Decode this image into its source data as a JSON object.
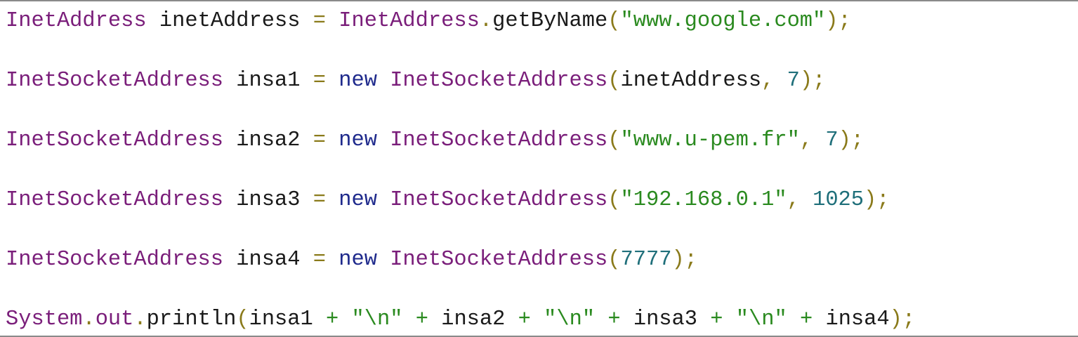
{
  "colors": {
    "type": "#7a1e7a",
    "keyword": "#1f2a8c",
    "string": "#2a8a1f",
    "number": "#1f6f7a",
    "punctuation": "#8a7a1a",
    "identifier": "#1a1a1a",
    "border": "#8a8a8a"
  },
  "code": {
    "lines": [
      {
        "tokens": [
          {
            "t": "type",
            "v": "InetAddress"
          },
          {
            "t": "ident",
            "v": " inetAddress "
          },
          {
            "t": "punct",
            "v": "="
          },
          {
            "t": "ident",
            "v": " "
          },
          {
            "t": "type",
            "v": "InetAddress"
          },
          {
            "t": "punct",
            "v": "."
          },
          {
            "t": "ident",
            "v": "getByName"
          },
          {
            "t": "punct",
            "v": "("
          },
          {
            "t": "str",
            "v": "\"www.google.com\""
          },
          {
            "t": "punct",
            "v": ");"
          }
        ]
      },
      {
        "tokens": [
          {
            "t": "type",
            "v": "InetSocketAddress"
          },
          {
            "t": "ident",
            "v": " insa1 "
          },
          {
            "t": "punct",
            "v": "="
          },
          {
            "t": "ident",
            "v": " "
          },
          {
            "t": "kw",
            "v": "new"
          },
          {
            "t": "ident",
            "v": " "
          },
          {
            "t": "type",
            "v": "InetSocketAddress"
          },
          {
            "t": "punct",
            "v": "("
          },
          {
            "t": "ident",
            "v": "inetAddress"
          },
          {
            "t": "punct",
            "v": ","
          },
          {
            "t": "ident",
            "v": " "
          },
          {
            "t": "num",
            "v": "7"
          },
          {
            "t": "punct",
            "v": ");"
          }
        ]
      },
      {
        "tokens": [
          {
            "t": "type",
            "v": "InetSocketAddress"
          },
          {
            "t": "ident",
            "v": " insa2 "
          },
          {
            "t": "punct",
            "v": "="
          },
          {
            "t": "ident",
            "v": " "
          },
          {
            "t": "kw",
            "v": "new"
          },
          {
            "t": "ident",
            "v": " "
          },
          {
            "t": "type",
            "v": "InetSocketAddress"
          },
          {
            "t": "punct",
            "v": "("
          },
          {
            "t": "str",
            "v": "\"www.u-pem.fr\""
          },
          {
            "t": "punct",
            "v": ","
          },
          {
            "t": "ident",
            "v": " "
          },
          {
            "t": "num",
            "v": "7"
          },
          {
            "t": "punct",
            "v": ");"
          }
        ]
      },
      {
        "tokens": [
          {
            "t": "type",
            "v": "InetSocketAddress"
          },
          {
            "t": "ident",
            "v": " insa3 "
          },
          {
            "t": "punct",
            "v": "="
          },
          {
            "t": "ident",
            "v": " "
          },
          {
            "t": "kw",
            "v": "new"
          },
          {
            "t": "ident",
            "v": " "
          },
          {
            "t": "type",
            "v": "InetSocketAddress"
          },
          {
            "t": "punct",
            "v": "("
          },
          {
            "t": "str",
            "v": "\"192.168.0.1\""
          },
          {
            "t": "punct",
            "v": ","
          },
          {
            "t": "ident",
            "v": " "
          },
          {
            "t": "num",
            "v": "1025"
          },
          {
            "t": "punct",
            "v": ");"
          }
        ]
      },
      {
        "tokens": [
          {
            "t": "type",
            "v": "InetSocketAddress"
          },
          {
            "t": "ident",
            "v": " insa4 "
          },
          {
            "t": "punct",
            "v": "="
          },
          {
            "t": "ident",
            "v": " "
          },
          {
            "t": "kw",
            "v": "new"
          },
          {
            "t": "ident",
            "v": " "
          },
          {
            "t": "type",
            "v": "InetSocketAddress"
          },
          {
            "t": "punct",
            "v": "("
          },
          {
            "t": "num",
            "v": "7777"
          },
          {
            "t": "punct",
            "v": ");"
          }
        ]
      },
      {
        "tokens": [
          {
            "t": "type",
            "v": "System"
          },
          {
            "t": "punct",
            "v": "."
          },
          {
            "t": "field",
            "v": "out"
          },
          {
            "t": "punct",
            "v": "."
          },
          {
            "t": "ident",
            "v": "println"
          },
          {
            "t": "punct",
            "v": "("
          },
          {
            "t": "ident",
            "v": "insa1 "
          },
          {
            "t": "str",
            "v": "+"
          },
          {
            "t": "ident",
            "v": " "
          },
          {
            "t": "str",
            "v": "\"\\n\""
          },
          {
            "t": "ident",
            "v": " "
          },
          {
            "t": "str",
            "v": "+"
          },
          {
            "t": "ident",
            "v": " insa2 "
          },
          {
            "t": "str",
            "v": "+"
          },
          {
            "t": "ident",
            "v": " "
          },
          {
            "t": "str",
            "v": "\"\\n\""
          },
          {
            "t": "ident",
            "v": " "
          },
          {
            "t": "str",
            "v": "+"
          },
          {
            "t": "ident",
            "v": " insa3 "
          },
          {
            "t": "str",
            "v": "+"
          },
          {
            "t": "ident",
            "v": " "
          },
          {
            "t": "str",
            "v": "\"\\n\""
          },
          {
            "t": "ident",
            "v": " "
          },
          {
            "t": "str",
            "v": "+"
          },
          {
            "t": "ident",
            "v": " insa4"
          },
          {
            "t": "punct",
            "v": ");"
          }
        ]
      }
    ]
  }
}
